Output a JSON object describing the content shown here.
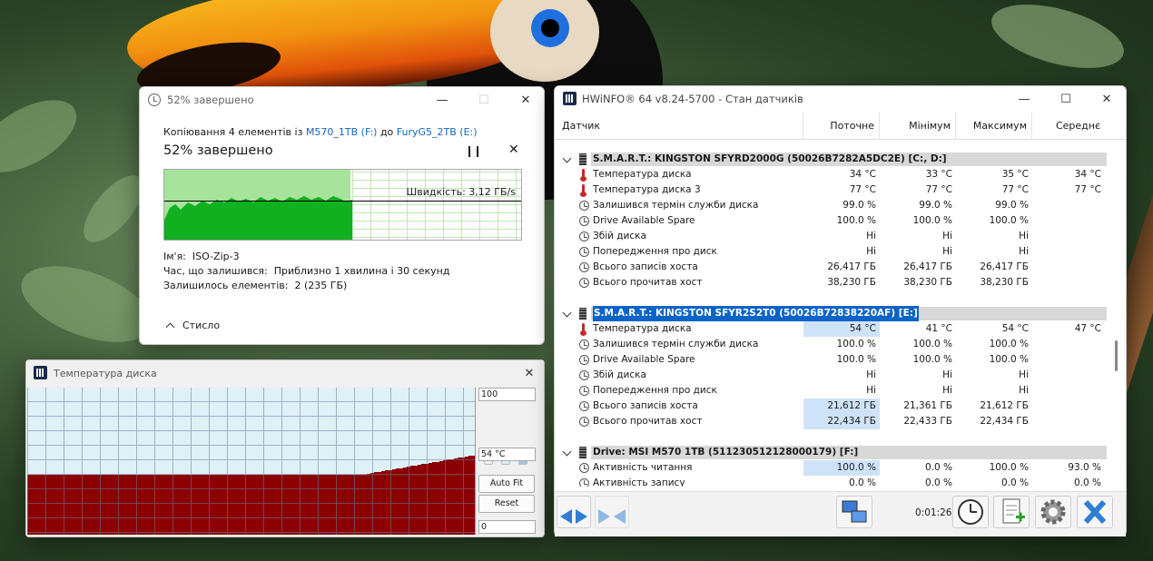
{
  "copy_dialog": {
    "title": "52% завершено",
    "line_prefix": "Копіювання 4 елементів із",
    "source": "M570_1TB (F:)",
    "line_mid": "до",
    "dest": "FuryG5_2TB (E:)",
    "heading": "52% завершено",
    "progress_percent": 52,
    "speed": "Швидкість: 3,12 ГБ/s",
    "name_label": "Ім'я:",
    "name_value": "ISO-Zip-3",
    "time_label": "Час, що залишився:",
    "time_value": "Приблизно 1 хвилина і 30 секунд",
    "items_label": "Залишилось елементів:",
    "items_value": "2 (235 ГБ)",
    "collapse_label": "Стисло"
  },
  "temp_window": {
    "title": "Температура диска",
    "max_label": "100",
    "current_label": "54 °C",
    "min_label": "0",
    "autofit_label": "Auto Fit",
    "reset_label": "Reset",
    "series_color": "#8b0000"
  },
  "hwinfo": {
    "title": "HWiNFO® 64 v8.24-5700 - Стан датчиків",
    "columns": [
      "Датчик",
      "Поточне",
      "Мінімум",
      "Максимум",
      "Середнє"
    ],
    "groups": [
      {
        "label": "S.M.A.R.T.: KINGSTON SFYRD2000G (50026B7282A5DC2E) [C:, D:]",
        "rows": [
          {
            "icon": "thermometer-icon",
            "name": "Температура диска",
            "cur": "34 °C",
            "min": "33 °C",
            "max": "35 °C",
            "avg": "34 °C"
          },
          {
            "icon": "thermometer-icon",
            "name": "Температура диска 3",
            "cur": "77 °C",
            "min": "77 °C",
            "max": "77 °C",
            "avg": "77 °C"
          },
          {
            "icon": "gauge-icon",
            "name": "Залишився термін служби диска",
            "cur": "99.0 %",
            "min": "99.0 %",
            "max": "99.0 %",
            "avg": ""
          },
          {
            "icon": "gauge-icon",
            "name": "Drive Available Spare",
            "cur": "100.0 %",
            "min": "100.0 %",
            "max": "100.0 %",
            "avg": ""
          },
          {
            "icon": "gauge-icon",
            "name": "Збій диска",
            "cur": "Ні",
            "min": "Ні",
            "max": "Ні",
            "avg": ""
          },
          {
            "icon": "gauge-icon",
            "name": "Попередження про диск",
            "cur": "Ні",
            "min": "Ні",
            "max": "Ні",
            "avg": ""
          },
          {
            "icon": "gauge-icon",
            "name": "Всього записів хоста",
            "cur": "26,417 ГБ",
            "min": "26,417 ГБ",
            "max": "26,417 ГБ",
            "avg": ""
          },
          {
            "icon": "gauge-icon",
            "name": "Всього прочитав хост",
            "cur": "38,230 ГБ",
            "min": "38,230 ГБ",
            "max": "38,230 ГБ",
            "avg": ""
          }
        ]
      },
      {
        "label": "S.M.A.R.T.: KINGSTON SFYR2S2T0 (50026B72838220AF) [E:]",
        "rows": [
          {
            "icon": "thermometer-icon",
            "name": "Температура диска",
            "cur": "54 °C",
            "min": "41 °C",
            "max": "54 °C",
            "avg": "47 °C"
          },
          {
            "icon": "gauge-icon",
            "name": "Залишився термін служби диска",
            "cur": "100.0 %",
            "min": "100.0 %",
            "max": "100.0 %",
            "avg": ""
          },
          {
            "icon": "gauge-icon",
            "name": "Drive Available Spare",
            "cur": "100.0 %",
            "min": "100.0 %",
            "max": "100.0 %",
            "avg": ""
          },
          {
            "icon": "gauge-icon",
            "name": "Збій диска",
            "cur": "Ні",
            "min": "Ні",
            "max": "Ні",
            "avg": ""
          },
          {
            "icon": "gauge-icon",
            "name": "Попередження про диск",
            "cur": "Ні",
            "min": "Ні",
            "max": "Ні",
            "avg": ""
          },
          {
            "icon": "gauge-icon",
            "name": "Всього записів хоста",
            "cur": "21,612 ГБ",
            "min": "21,361 ГБ",
            "max": "21,612 ГБ",
            "avg": ""
          },
          {
            "icon": "gauge-icon",
            "name": "Всього прочитав хост",
            "cur": "22,434 ГБ",
            "min": "22,433 ГБ",
            "max": "22,434 ГБ",
            "avg": ""
          }
        ]
      },
      {
        "label": "Drive: MSI M570 1TB (511230512128000179) [F:]",
        "rows": [
          {
            "icon": "gauge-icon",
            "name": "Активність читання",
            "cur": "100.0 %",
            "min": "0.0 %",
            "max": "100.0 %",
            "avg": "93.0 %"
          },
          {
            "icon": "gauge-icon",
            "name": "Активність запису",
            "cur": "0.0 %",
            "min": "0.0 %",
            "max": "0.0 %",
            "avg": "0.0 %"
          }
        ]
      }
    ],
    "elapsed": "0:01:26"
  }
}
